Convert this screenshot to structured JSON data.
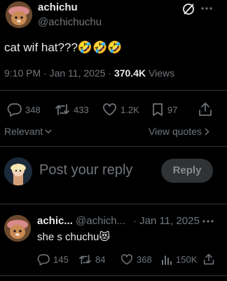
{
  "post": {
    "display_name": "achichu",
    "handle": "@achichuchu",
    "text": "cat wif hat???",
    "emoji": "🤣🤣🤣",
    "time": "9:10 PM · Jan 11, 2025 · ",
    "views_count": "370.4K",
    "views_label": " Views",
    "stats": {
      "replies": "348",
      "reposts": "433",
      "likes": "1.2K",
      "bookmarks": "97"
    }
  },
  "controls": {
    "sort_label": "Relevant",
    "view_quotes": "View quotes"
  },
  "composer": {
    "placeholder": "Post your reply",
    "reply_button": "Reply"
  },
  "reply": {
    "display_name": "achic...",
    "handle": "@achich...",
    "date": "· Jan 11, 2025",
    "text": "she s chuchu",
    "emoji": "😻",
    "stats": {
      "replies": "145",
      "reposts": "84",
      "likes": "368",
      "views": "150K"
    }
  },
  "colors": {
    "background": "#000000",
    "text": "#e7e9ea",
    "muted": "#71767b",
    "divider": "#2f3336"
  },
  "icons": [
    "grok-icon",
    "more-icon",
    "reply-icon",
    "repost-icon",
    "like-icon",
    "bookmark-icon",
    "share-icon",
    "chevron-down-icon",
    "chevron-right-icon",
    "analytics-icon"
  ]
}
